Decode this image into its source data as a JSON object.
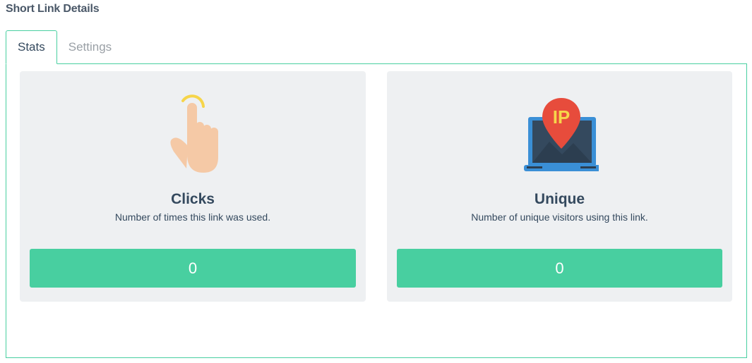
{
  "header": {
    "title": "Short Link Details"
  },
  "tabs": [
    {
      "label": "Stats",
      "active": true
    },
    {
      "label": "Settings",
      "active": false
    }
  ],
  "cards": [
    {
      "icon": "pointing-hand-icon",
      "title": "Clicks",
      "description": "Number of times this link was used.",
      "value": "0"
    },
    {
      "icon": "ip-laptop-icon",
      "title": "Unique",
      "description": "Number of unique visitors using this link.",
      "value": "0",
      "icon_text": "IP"
    }
  ],
  "colors": {
    "accent": "#48cfa0",
    "card_bg": "#eef0f2",
    "text": "#34495e"
  }
}
